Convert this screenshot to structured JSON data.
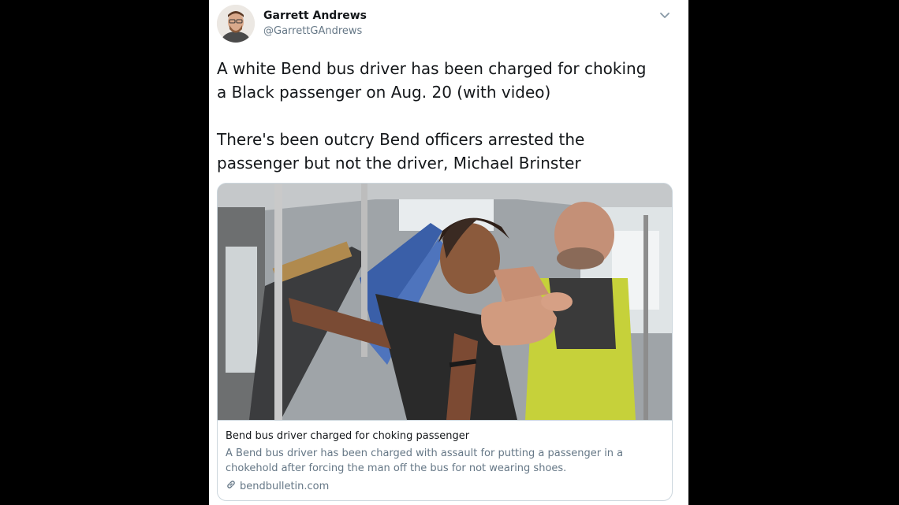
{
  "tweet": {
    "author_name": "Garrett Andrews",
    "author_handle": "@GarrettGAndrews",
    "text": "A white Bend bus driver has been charged for choking\na Black passenger on Aug. 20 (with video)\n\nThere's been outcry Bend officers arrested the\npassenger but not the driver, Michael Brinster",
    "caret_icon": "chevron-down-icon",
    "avatar_icon": "avatar"
  },
  "link_card": {
    "title": "Bend bus driver charged for choking passenger",
    "description": "A Bend bus driver has been charged with assault for putting a passenger in a chokehold after forcing the man off the bus for not wearing shoes.",
    "domain": "bendbulletin.com",
    "domain_icon": "link-icon"
  },
  "colors": {
    "background": "#000000",
    "card": "#ffffff",
    "primary_text": "#14171a",
    "secondary_text": "#657786",
    "border": "#ccd6dd"
  }
}
